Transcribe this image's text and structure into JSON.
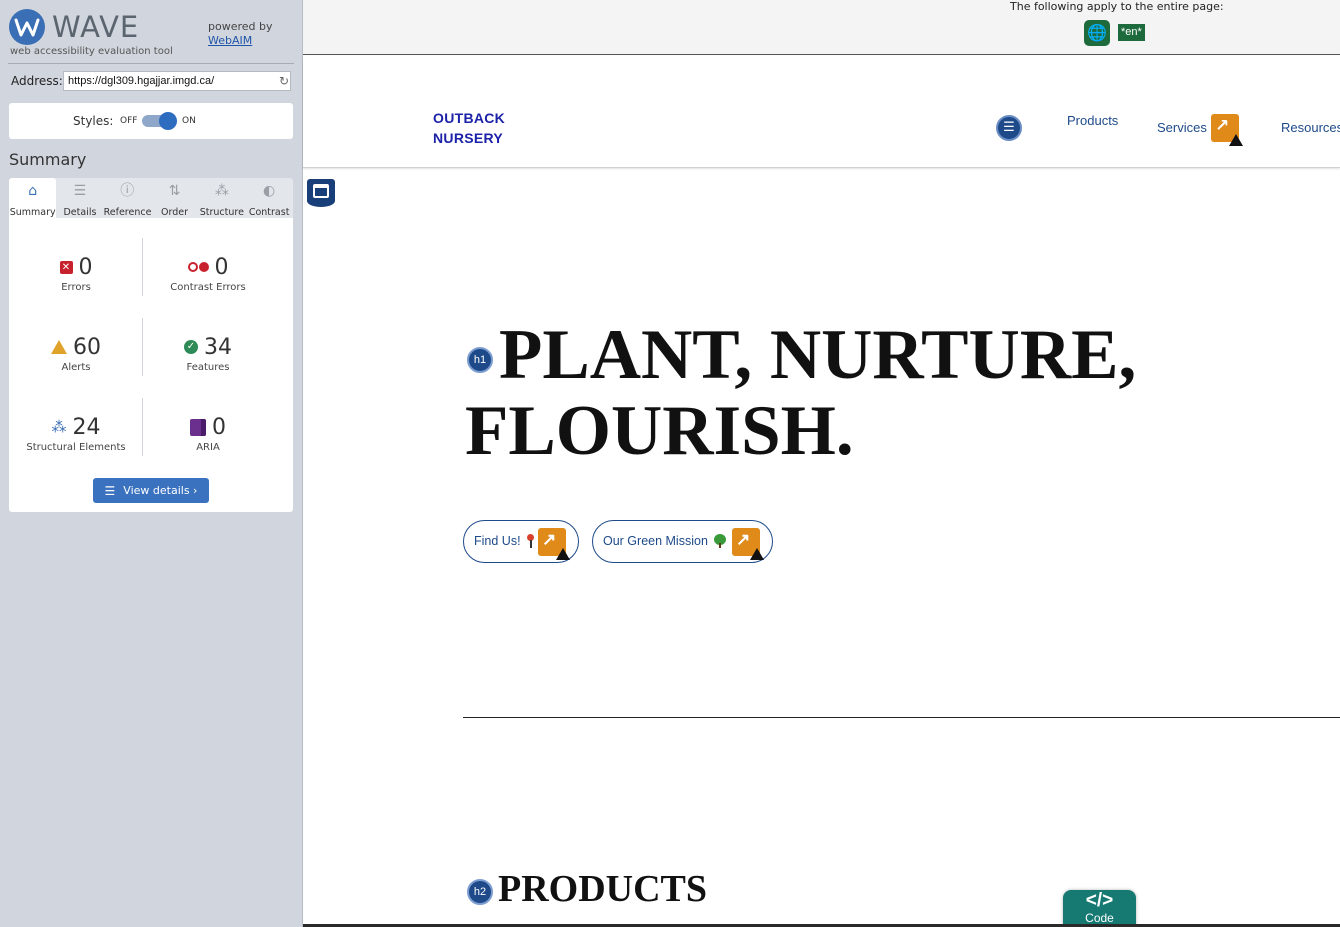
{
  "wave": {
    "logo_text": "WAVE",
    "tagline": "web accessibility evaluation tool",
    "powered_by": "powered by",
    "webaim_link": "WebAIM",
    "address_label": "Address:",
    "address_value": "https://dgl309.hgajjar.imgd.ca/",
    "styles_label": "Styles:",
    "styles_off": "OFF",
    "styles_on": "ON",
    "styles_state": "on",
    "summary_title": "Summary",
    "tabs": [
      {
        "label": "Summary",
        "icon": "home-icon",
        "active": true
      },
      {
        "label": "Details",
        "icon": "list-icon",
        "active": false
      },
      {
        "label": "Reference",
        "icon": "info-icon",
        "active": false
      },
      {
        "label": "Order",
        "icon": "order-icon",
        "active": false
      },
      {
        "label": "Structure",
        "icon": "structure-icon",
        "active": false
      },
      {
        "label": "Contrast",
        "icon": "contrast-icon",
        "active": false
      }
    ],
    "stats": {
      "errors": {
        "value": "0",
        "label": "Errors"
      },
      "contrast_errors": {
        "value": "0",
        "label": "Contrast Errors"
      },
      "alerts": {
        "value": "60",
        "label": "Alerts"
      },
      "features": {
        "value": "34",
        "label": "Features"
      },
      "structural": {
        "value": "24",
        "label": "Structural Elements"
      },
      "aria": {
        "value": "0",
        "label": "ARIA"
      }
    },
    "view_details": "View details ›",
    "colors": {
      "accent": "#3a72bf",
      "error": "#c8212e",
      "alert": "#e0a32a",
      "feature": "#2e8b57",
      "aria": "#6b2f8e"
    }
  },
  "page": {
    "topbar_note": "The following apply to the entire page:",
    "lang_badge": "*en*",
    "brand_line1": "OUTBACK",
    "brand_line2": "NURSERY",
    "nav": {
      "products": "Products",
      "services": "Services",
      "resources": "Resources"
    },
    "h1_badge": "h1",
    "hero_title": "PLANT, NURTURE, FLOURISH.",
    "btn_find": "Find Us!",
    "btn_mission": "Our Green Mission",
    "h2_badge": "h2",
    "products_title": "PRODUCTS",
    "code_symbol": "</>",
    "code_label": "Code"
  }
}
